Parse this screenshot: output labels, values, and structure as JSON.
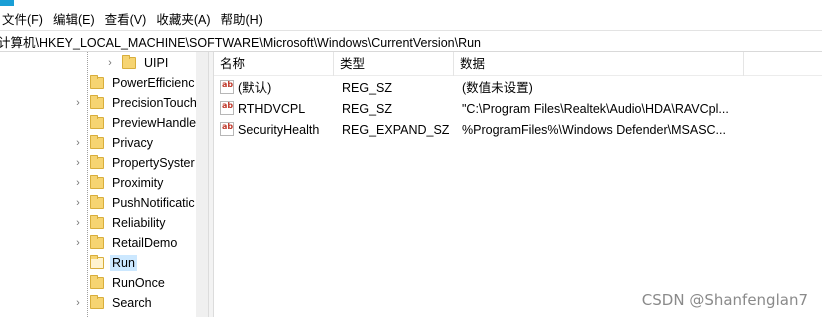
{
  "menu": [
    "文件(F)",
    "编辑(E)",
    "查看(V)",
    "收藏夹(A)",
    "帮助(H)"
  ],
  "address": "计算机\\HKEY_LOCAL_MACHINE\\SOFTWARE\\Microsoft\\Windows\\CurrentVersion\\Run",
  "tree": [
    {
      "label": "UIPI",
      "expandable": true,
      "selected": false
    },
    {
      "label": "PowerEfficienc",
      "expandable": false,
      "selected": false
    },
    {
      "label": "PrecisionTouch",
      "expandable": true,
      "selected": false
    },
    {
      "label": "PreviewHandle",
      "expandable": false,
      "selected": false
    },
    {
      "label": "Privacy",
      "expandable": true,
      "selected": false
    },
    {
      "label": "PropertySyster",
      "expandable": true,
      "selected": false
    },
    {
      "label": "Proximity",
      "expandable": true,
      "selected": false
    },
    {
      "label": "PushNotificatic",
      "expandable": true,
      "selected": false
    },
    {
      "label": "Reliability",
      "expandable": true,
      "selected": false
    },
    {
      "label": "RetailDemo",
      "expandable": true,
      "selected": false
    },
    {
      "label": "Run",
      "expandable": false,
      "selected": true
    },
    {
      "label": "RunOnce",
      "expandable": false,
      "selected": false
    },
    {
      "label": "Search",
      "expandable": true,
      "selected": false
    }
  ],
  "columns": {
    "name": "名称",
    "type": "类型",
    "data": "数据"
  },
  "rows": [
    {
      "name": "(默认)",
      "type": "REG_SZ",
      "data": "(数值未设置)"
    },
    {
      "name": "RTHDVCPL",
      "type": "REG_SZ",
      "data": "\"C:\\Program Files\\Realtek\\Audio\\HDA\\RAVCpl..."
    },
    {
      "name": "SecurityHealth",
      "type": "REG_EXPAND_SZ",
      "data": "%ProgramFiles%\\Windows Defender\\MSASC..."
    }
  ],
  "icon_text": "ab",
  "watermark": "CSDN @Shanfenglan7",
  "colors": {
    "selection": "#cce8ff",
    "folder": "#f6d472",
    "accent": "#1a9fd6"
  }
}
